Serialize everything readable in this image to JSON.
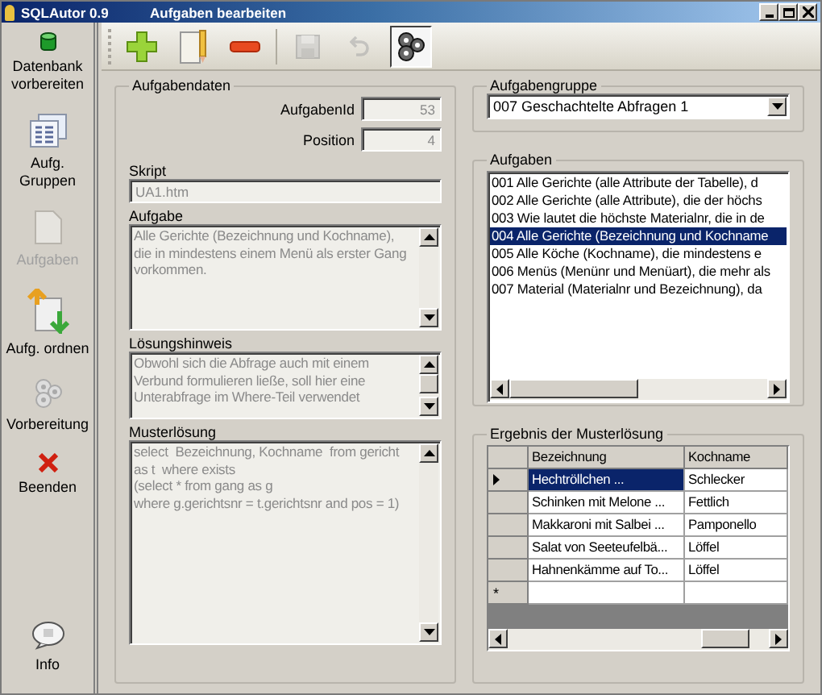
{
  "window": {
    "app_title": "SQLAutor 0.9",
    "title": "Aufgaben bearbeiten"
  },
  "sidebar": {
    "items": [
      {
        "kind": "database",
        "label": "Datenbank vorbereiten",
        "disabled": false
      },
      {
        "kind": "groups",
        "label": "Aufg. Gruppen",
        "disabled": false
      },
      {
        "kind": "page",
        "label": "Aufgaben",
        "disabled": true
      },
      {
        "kind": "order",
        "label": "Aufg. ordnen",
        "disabled": false
      },
      {
        "kind": "gears",
        "label": "Vorbereitung",
        "disabled": false
      },
      {
        "kind": "close",
        "label": "Beenden",
        "disabled": false
      },
      {
        "kind": "info",
        "label": "Info",
        "disabled": false
      }
    ]
  },
  "toolbar": [
    {
      "kind": "add",
      "disabled": false,
      "pressed": false
    },
    {
      "kind": "edit",
      "disabled": false,
      "pressed": false
    },
    {
      "kind": "delete",
      "disabled": false,
      "pressed": false
    },
    {
      "kind": "separator"
    },
    {
      "kind": "save",
      "disabled": true,
      "pressed": false
    },
    {
      "kind": "undo",
      "disabled": true,
      "pressed": false
    },
    {
      "kind": "gears",
      "disabled": false,
      "pressed": true
    }
  ],
  "task_data": {
    "title": "Aufgabendaten",
    "aufgaben_id": {
      "label": "AufgabenId",
      "value": "53"
    },
    "position": {
      "label": "Position",
      "value": "4"
    },
    "script": {
      "label": "Skript",
      "value": "UA1.htm"
    },
    "task": {
      "label": "Aufgabe",
      "value": "Alle Gerichte (Bezeichnung und Kochname),\ndie in mindestens einem Menü als erster Gang vorkommen."
    },
    "hint": {
      "label": "Lösungshinweis",
      "value": "Obwohl sich die Abfrage auch mit einem Verbund formulieren ließe, soll hier eine Unterabfrage im Where-Teil verwendet"
    },
    "solution": {
      "label": "Musterlösung",
      "value": "select  Bezeichnung, Kochname  from gericht\nas t  where exists\n(select * from gang as g\nwhere g.gerichtsnr = t.gerichtsnr and pos = 1)"
    }
  },
  "task_group": {
    "title": "Aufgabengruppe",
    "value": "007  Geschachtelte Abfragen 1"
  },
  "tasks": {
    "title": "Aufgaben",
    "items": [
      {
        "label": "001  Alle Gerichte (alle Attribute der Tabelle), d",
        "selected": false
      },
      {
        "label": "002  Alle Gerichte (alle Attribute), die der höchs",
        "selected": false
      },
      {
        "label": "003  Wie lautet die höchste Materialnr, die in de",
        "selected": false
      },
      {
        "label": "004  Alle Gerichte (Bezeichnung und Kochname",
        "selected": true
      },
      {
        "label": "005  Alle Köche (Kochname), die mindestens e",
        "selected": false
      },
      {
        "label": "006  Menüs (Menünr und Menüart), die mehr als",
        "selected": false
      },
      {
        "label": "007  Material (Materialnr und Bezeichnung), da",
        "selected": false
      }
    ]
  },
  "result": {
    "title": "Ergebnis der Musterlösung",
    "columns": [
      "Bezeichnung",
      "Kochname"
    ],
    "rows": [
      {
        "cells": [
          "Hechtröllchen             ...",
          "Schlecker"
        ],
        "selected": true
      },
      {
        "cells": [
          "Schinken mit Melone  ...",
          "Fettlich"
        ],
        "selected": false
      },
      {
        "cells": [
          "Makkaroni mit Salbei ...",
          "Pamponello"
        ],
        "selected": false
      },
      {
        "cells": [
          "Salat von Seeteufelbä...",
          "Löffel"
        ],
        "selected": false
      },
      {
        "cells": [
          "Hahnenkämme auf To...",
          "Löffel"
        ],
        "selected": false
      }
    ],
    "new_row_marker": "*"
  }
}
